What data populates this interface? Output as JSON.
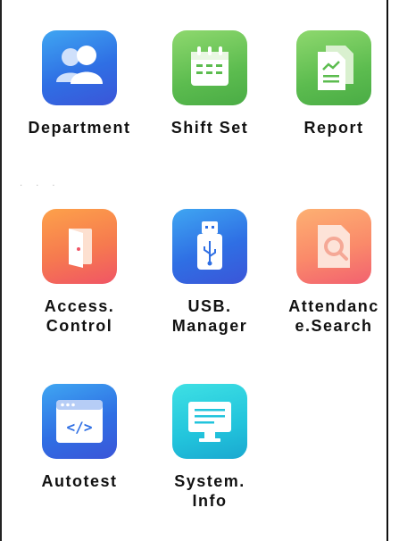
{
  "menu": {
    "items": [
      {
        "label_lines": [
          "Department"
        ],
        "icon": "department-icon"
      },
      {
        "label_lines": [
          "Shift Set"
        ],
        "icon": "calendar-icon"
      },
      {
        "label_lines": [
          "Report"
        ],
        "icon": "report-icon"
      },
      {
        "label_lines": [
          "Access.",
          "Control"
        ],
        "icon": "door-icon"
      },
      {
        "label_lines": [
          "USB.",
          "Manager"
        ],
        "icon": "usb-icon"
      },
      {
        "label_lines": [
          "Attendanc",
          "e.Search"
        ],
        "icon": "search-document-icon"
      },
      {
        "label_lines": [
          "Autotest"
        ],
        "icon": "code-window-icon"
      },
      {
        "label_lines": [
          "System.",
          "Info"
        ],
        "icon": "monitor-icon"
      }
    ]
  },
  "colors": {
    "blue": "#2f6fe4",
    "green": "#5cbc4f",
    "orange": "#f67a4f",
    "cyan": "#22c4dc"
  }
}
